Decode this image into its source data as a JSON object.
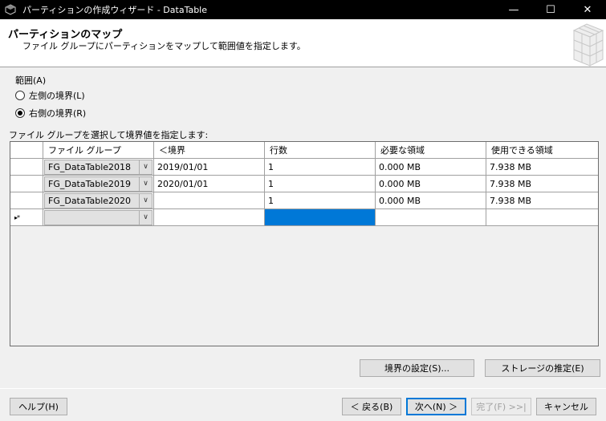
{
  "window": {
    "title": "パーティションの作成ウィザード - DataTable",
    "minimize": "—",
    "maximize": "☐",
    "close": "✕"
  },
  "header": {
    "title": "パーティションのマップ",
    "subtitle": "ファイル グループにパーティションをマップして範囲値を指定します。"
  },
  "range": {
    "label": "範囲(A)",
    "options": [
      {
        "label": "左側の境界(L)",
        "checked": false
      },
      {
        "label": "右側の境界(R)",
        "checked": true
      }
    ]
  },
  "grid": {
    "caption": "ファイル グループを選択して境界値を指定します:",
    "columns": [
      "",
      "ファイル グループ",
      "＜境界",
      "行数",
      "必要な領域",
      "使用できる領域"
    ],
    "rows": [
      {
        "filegroup": "FG_DataTable2018",
        "boundary": "2019/01/01",
        "rows": "1",
        "required": "0.000 MB",
        "available": "7.938 MB"
      },
      {
        "filegroup": "FG_DataTable2019",
        "boundary": "2020/01/01",
        "rows": "1",
        "required": "0.000 MB",
        "available": "7.938 MB"
      },
      {
        "filegroup": "FG_DataTable2020",
        "boundary": "",
        "rows": "1",
        "required": "0.000 MB",
        "available": "7.938 MB"
      }
    ],
    "new_row_marker": "▸*"
  },
  "buttons": {
    "set_boundaries": "境界の設定(S)...",
    "estimate_storage": "ストレージの推定(E)",
    "help": "ヘルプ(H)",
    "back": "＜ 戻る(B)",
    "next": "次へ(N) ＞",
    "finish": "完了(F) >>|",
    "cancel": "キャンセル"
  }
}
